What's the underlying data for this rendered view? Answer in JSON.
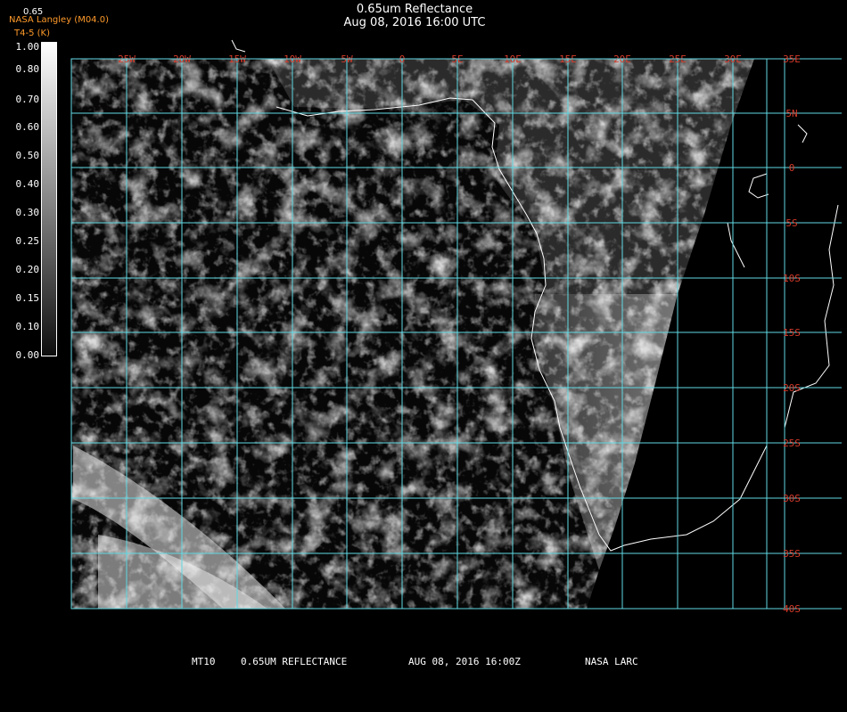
{
  "header": {
    "title": "0.65um Reflectance",
    "datetime": "Aug 08, 2016 16:00 UTC",
    "credit": "NASA Langley (M04.0)",
    "credit_sub": "T4-5 (K)",
    "band_code": "0.65"
  },
  "colorbar": {
    "ticks": [
      "1.00",
      "0.80",
      "0.70",
      "0.60",
      "0.50",
      "0.40",
      "0.30",
      "0.25",
      "0.20",
      "0.15",
      "0.10",
      "0.00"
    ]
  },
  "map": {
    "lon_labels": [
      "25W",
      "20W",
      "15W",
      "10W",
      "5W",
      "0",
      "5E",
      "10E",
      "15E",
      "20E",
      "25E",
      "30E"
    ],
    "lat_labels": [
      "35E",
      "5N",
      "0",
      "5S",
      "10S",
      "15S",
      "20S",
      "25S",
      "30S",
      "35S",
      "40S"
    ],
    "grid_color": "#5fd9e3",
    "label_color": "#d63a2a",
    "coast_color": "#ffffff"
  },
  "footer": {
    "satellite": "MT10",
    "product": "0.65UM REFLECTANCE",
    "date": "AUG 08, 2016 16:00Z",
    "source": "NASA LARC"
  }
}
